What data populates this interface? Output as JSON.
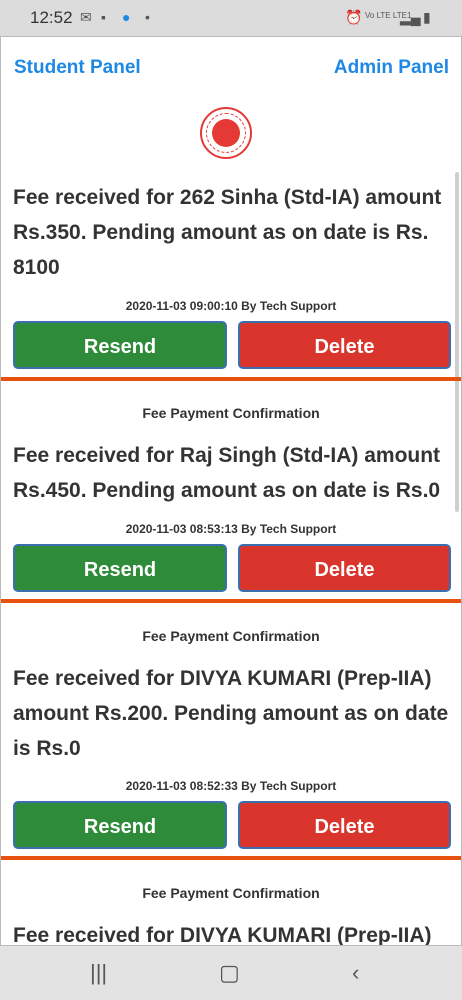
{
  "status": {
    "time": "12:52",
    "lte": "Vo LTE LTE1"
  },
  "header": {
    "student_panel": "Student Panel",
    "admin_panel": "Admin Panel"
  },
  "cards": [
    {
      "heading": "",
      "message": "Fee received for 262 Sinha (Std-IA) amount Rs.350. Pending amount as on date is Rs. 8100",
      "meta": "2020-11-03 09:00:10 By Tech Support",
      "resend": "Resend",
      "delete": "Delete"
    },
    {
      "heading": "Fee Payment Confirmation",
      "message": "Fee received for Raj Singh (Std-IA) amount Rs.450. Pending amount as on date is Rs.0",
      "meta": "2020-11-03 08:53:13 By Tech Support",
      "resend": "Resend",
      "delete": "Delete"
    },
    {
      "heading": "Fee Payment Confirmation",
      "message": "Fee received for DIVYA KUMARI  (Prep-IIA) amount Rs.200. Pending amount as on date is Rs.0",
      "meta": "2020-11-03 08:52:33 By Tech Support",
      "resend": "Resend",
      "delete": "Delete"
    },
    {
      "heading": "Fee Payment Confirmation",
      "message": "Fee received for DIVYA KUMARI  (Prep-IIA)"
    }
  ]
}
